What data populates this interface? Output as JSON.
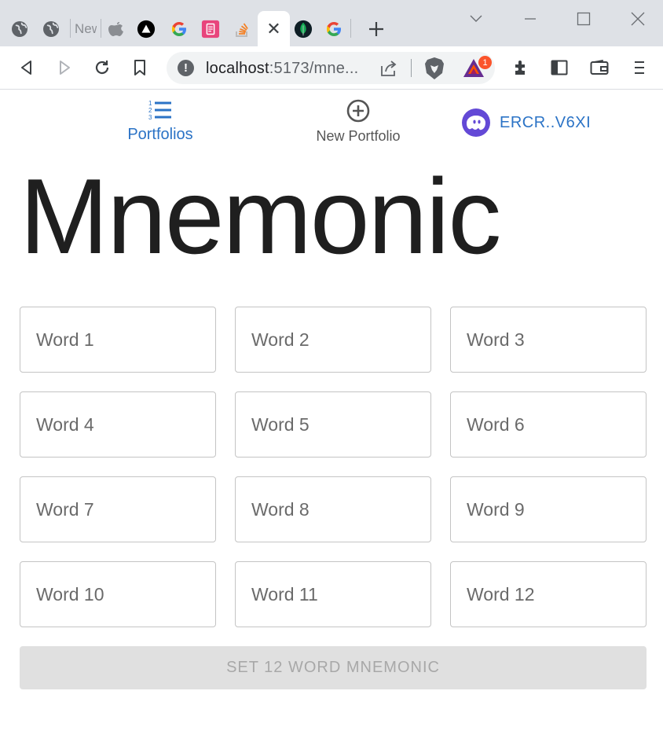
{
  "browser": {
    "tabs": [
      {
        "icon": "globe-icon"
      },
      {
        "icon": "globe-icon"
      },
      {
        "icon": "new-tab-icon",
        "title": "New"
      },
      {
        "icon": "apple-icon"
      },
      {
        "icon": "triangle-logo-icon"
      },
      {
        "icon": "google-icon"
      },
      {
        "icon": "clipboard-icon"
      },
      {
        "icon": "stackoverflow-icon"
      },
      {
        "icon": "close-icon",
        "active": true
      },
      {
        "icon": "mongodb-leaf-icon"
      },
      {
        "icon": "google-icon"
      }
    ],
    "url_host": "localhost",
    "url_path": ":5173/mne...",
    "extension_badge": "1",
    "info_glyph": "!"
  },
  "nav": {
    "portfolios_label": "Portfolios",
    "new_portfolio_label": "New Portfolio",
    "account_label": "ERCR..V6XI"
  },
  "page": {
    "title": "Mnemonic",
    "submit_label": "SET 12 WORD MNEMONIC"
  },
  "words": [
    {
      "placeholder": "Word 1"
    },
    {
      "placeholder": "Word 2"
    },
    {
      "placeholder": "Word 3"
    },
    {
      "placeholder": "Word 4"
    },
    {
      "placeholder": "Word 5"
    },
    {
      "placeholder": "Word 6"
    },
    {
      "placeholder": "Word 7"
    },
    {
      "placeholder": "Word 8"
    },
    {
      "placeholder": "Word 9"
    },
    {
      "placeholder": "Word 10"
    },
    {
      "placeholder": "Word 11"
    },
    {
      "placeholder": "Word 12"
    }
  ],
  "colors": {
    "accent": "#2b73c6",
    "avatar": "#6349d6",
    "disabled_button": "#e0e0e0"
  }
}
